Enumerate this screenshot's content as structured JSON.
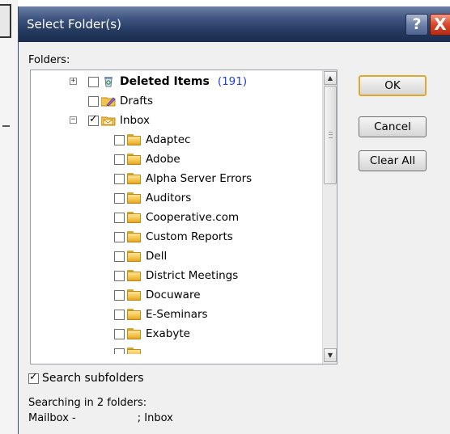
{
  "dialog": {
    "title": "Select Folder(s)",
    "help_label": "?",
    "close_label": "X",
    "folders_label": "Folders:"
  },
  "tree": {
    "deleted_items": {
      "label": "Deleted Items",
      "count": "(191)",
      "expander": "+",
      "checked": false
    },
    "drafts": {
      "label": "Drafts",
      "checked": false
    },
    "inbox": {
      "label": "Inbox",
      "expander": "−",
      "checked": true
    },
    "inbox_children": [
      {
        "label": "Adaptec"
      },
      {
        "label": "Adobe"
      },
      {
        "label": "Alpha Server Errors"
      },
      {
        "label": "Auditors"
      },
      {
        "label": "Cooperative.com"
      },
      {
        "label": "Custom Reports"
      },
      {
        "label": "Dell"
      },
      {
        "label": "District Meetings"
      },
      {
        "label": "Docuware"
      },
      {
        "label": "E-Seminars"
      },
      {
        "label": "Exabyte"
      }
    ]
  },
  "scrollbar": {
    "up_arrow": "▲",
    "down_arrow": "▼"
  },
  "buttons": {
    "ok": "OK",
    "cancel": "Cancel",
    "clear_all": "Clear All"
  },
  "search_subfolders": {
    "label": "Search subfolders",
    "checked": true
  },
  "status": {
    "searching_in": "Searching in 2 folders:",
    "mailbox_prefix": "Mailbox -",
    "mailbox_suffix": "; Inbox"
  },
  "colors": {
    "count": "#1f3fe0",
    "default_button_border": "#e0a92d",
    "title_bar": "#24395f"
  }
}
